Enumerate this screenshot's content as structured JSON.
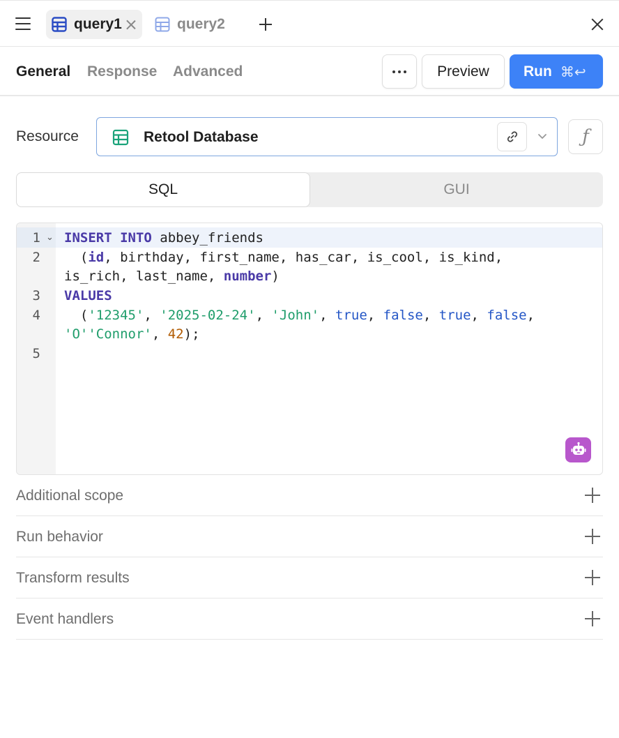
{
  "tabs": [
    {
      "label": "query1",
      "active": true
    },
    {
      "label": "query2",
      "active": false
    }
  ],
  "subtabs": [
    "General",
    "Response",
    "Advanced"
  ],
  "actions": {
    "more_label": "···",
    "preview_label": "Preview",
    "run_label": "Run",
    "run_shortcut": "⌘↩"
  },
  "resource": {
    "label": "Resource",
    "value": "Retool Database",
    "fx_label": "ƒ"
  },
  "mode": {
    "sql_label": "SQL",
    "gui_label": "GUI",
    "selected": "SQL"
  },
  "editor": {
    "line_numbers": [
      "1",
      "2",
      "3",
      "4",
      "5"
    ],
    "lines": [
      "INSERT INTO abbey_friends",
      "  (id, birthday, first_name, has_car, is_cool, is_kind,",
      "is_rich, last_name, number)",
      "VALUES",
      "  ('12345', '2025-02-24', 'John', true, false, true, false,",
      "'O''Connor', 42);"
    ]
  },
  "sections": [
    "Additional scope",
    "Run behavior",
    "Transform results",
    "Event handlers"
  ],
  "colors": {
    "accent": "#3d82f7",
    "keyword": "#4a3aa7",
    "string": "#1f9d6b",
    "boolean": "#2456c6",
    "number": "#b15a00",
    "ai_button": "#b857cc",
    "db_icon": "#1aa37a"
  },
  "icons": {
    "menu": "hamburger-icon",
    "table": "table-icon",
    "close": "close-icon",
    "add": "plus-icon",
    "database": "database-table-icon",
    "link": "link-icon",
    "chevron": "chevron-down-icon",
    "ai": "robot-icon"
  }
}
